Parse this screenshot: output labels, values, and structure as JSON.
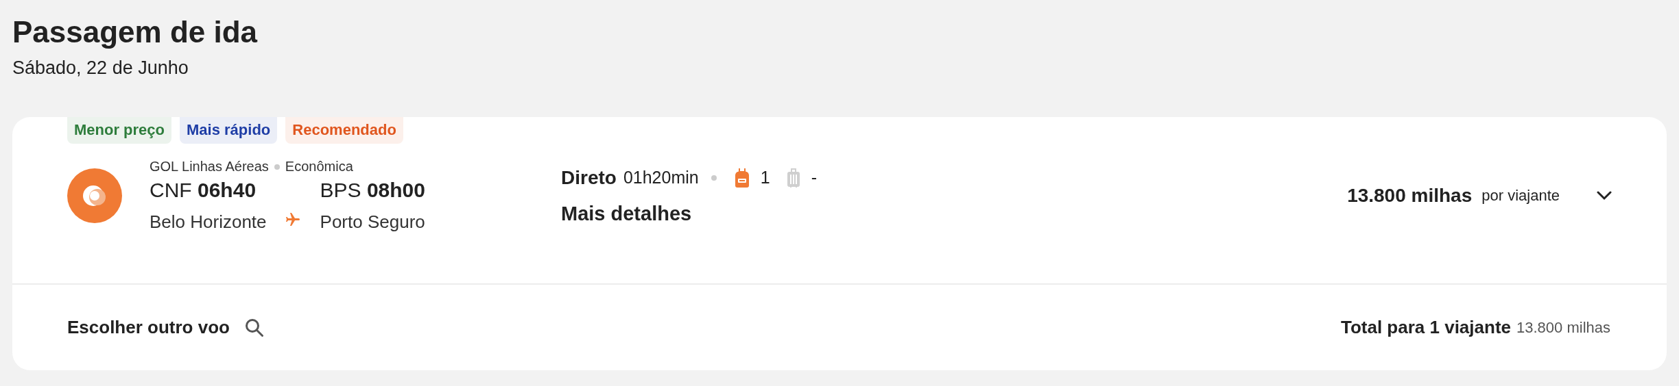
{
  "header": {
    "title": "Passagem de ida",
    "date": "Sábado, 22 de Junho"
  },
  "badges": [
    {
      "label": "Menor preço",
      "color": "#2e7d3c"
    },
    {
      "label": "Mais rápido",
      "color": "#1f3ea6"
    },
    {
      "label": "Recomendado",
      "color": "#e0561e"
    }
  ],
  "flight": {
    "airline": "GOL Linhas Aéreas",
    "cabin": "Econômica",
    "origin": {
      "code": "CNF",
      "time": "06h40",
      "city": "Belo Horizonte"
    },
    "destination": {
      "code": "BPS",
      "time": "08h00",
      "city": "Porto Seguro"
    },
    "stops": "Direto",
    "duration": "01h20min",
    "baggage": [
      {
        "kind": "backpack",
        "included": true,
        "count": "1"
      },
      {
        "kind": "suitcase",
        "included": false,
        "count": "-"
      }
    ],
    "details_link": "Mais detalhes",
    "price": "13.800 milhas",
    "price_note": "por viajante",
    "expanded": false
  },
  "footer": {
    "change_link": "Escolher outro voo",
    "total_label": "Total para 1 viajante",
    "total_value": "13.800 milhas"
  }
}
